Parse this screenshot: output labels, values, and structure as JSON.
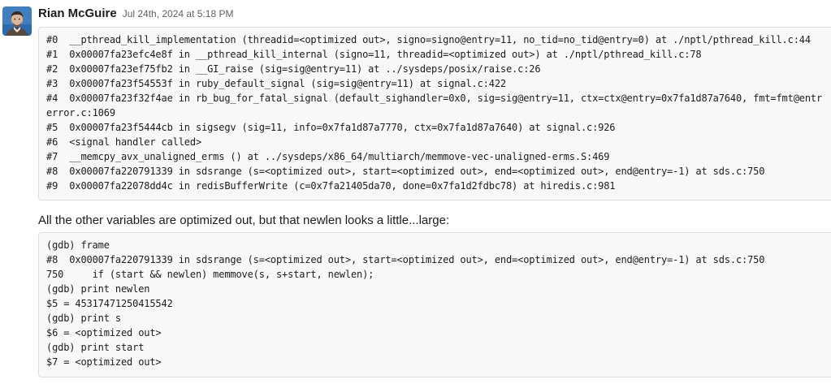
{
  "message": {
    "author": "Rian McGuire",
    "timestamp": "Jul 24th, 2024 at 5:18 PM",
    "avatar_icon": "user-avatar-photo"
  },
  "backtrace_lines": [
    "#0  __pthread_kill_implementation (threadid=<optimized out>, signo=signo@entry=11, no_tid=no_tid@entry=0) at ./nptl/pthread_kill.c:44",
    "#1  0x00007fa23efc4e8f in __pthread_kill_internal (signo=11, threadid=<optimized out>) at ./nptl/pthread_kill.c:78",
    "#2  0x00007fa23ef75fb2 in __GI_raise (sig=sig@entry=11) at ../sysdeps/posix/raise.c:26",
    "#3  0x00007fa23f54553f in ruby_default_signal (sig=sig@entry=11) at signal.c:422",
    "#4  0x00007fa23f32f4ae in rb_bug_for_fatal_signal (default_sighandler=0x0, sig=sig@entry=11, ctx=ctx@entry=0x7fa1d87a7640, fmt=fmt@entr",
    "error.c:1069",
    "#5  0x00007fa23f5444cb in sigsegv (sig=11, info=0x7fa1d87a7770, ctx=0x7fa1d87a7640) at signal.c:926",
    "#6  <signal handler called>",
    "#7  __memcpy_avx_unaligned_erms () at ../sysdeps/x86_64/multiarch/memmove-vec-unaligned-erms.S:469",
    "#8  0x00007fa220791339 in sdsrange (s=<optimized out>, start=<optimized out>, end=<optimized out>, end@entry=-1) at sds.c:750",
    "#9  0x00007fa22078dd4c in redisBufferWrite (c=0x7fa21405da70, done=0x7fa1d2fdbc78) at hiredis.c:981"
  ],
  "prose_text": "All the other variables are optimized out, but that newlen looks a little...large:",
  "gdb_lines": [
    "(gdb) frame",
    "#8  0x00007fa220791339 in sdsrange (s=<optimized out>, start=<optimized out>, end=<optimized out>, end@entry=-1) at sds.c:750",
    "750     if (start && newlen) memmove(s, s+start, newlen);",
    "(gdb) print newlen",
    "$5 = 45317471250415542",
    "(gdb) print s",
    "$6 = <optimized out>",
    "(gdb) print start",
    "$7 = <optimized out>"
  ]
}
